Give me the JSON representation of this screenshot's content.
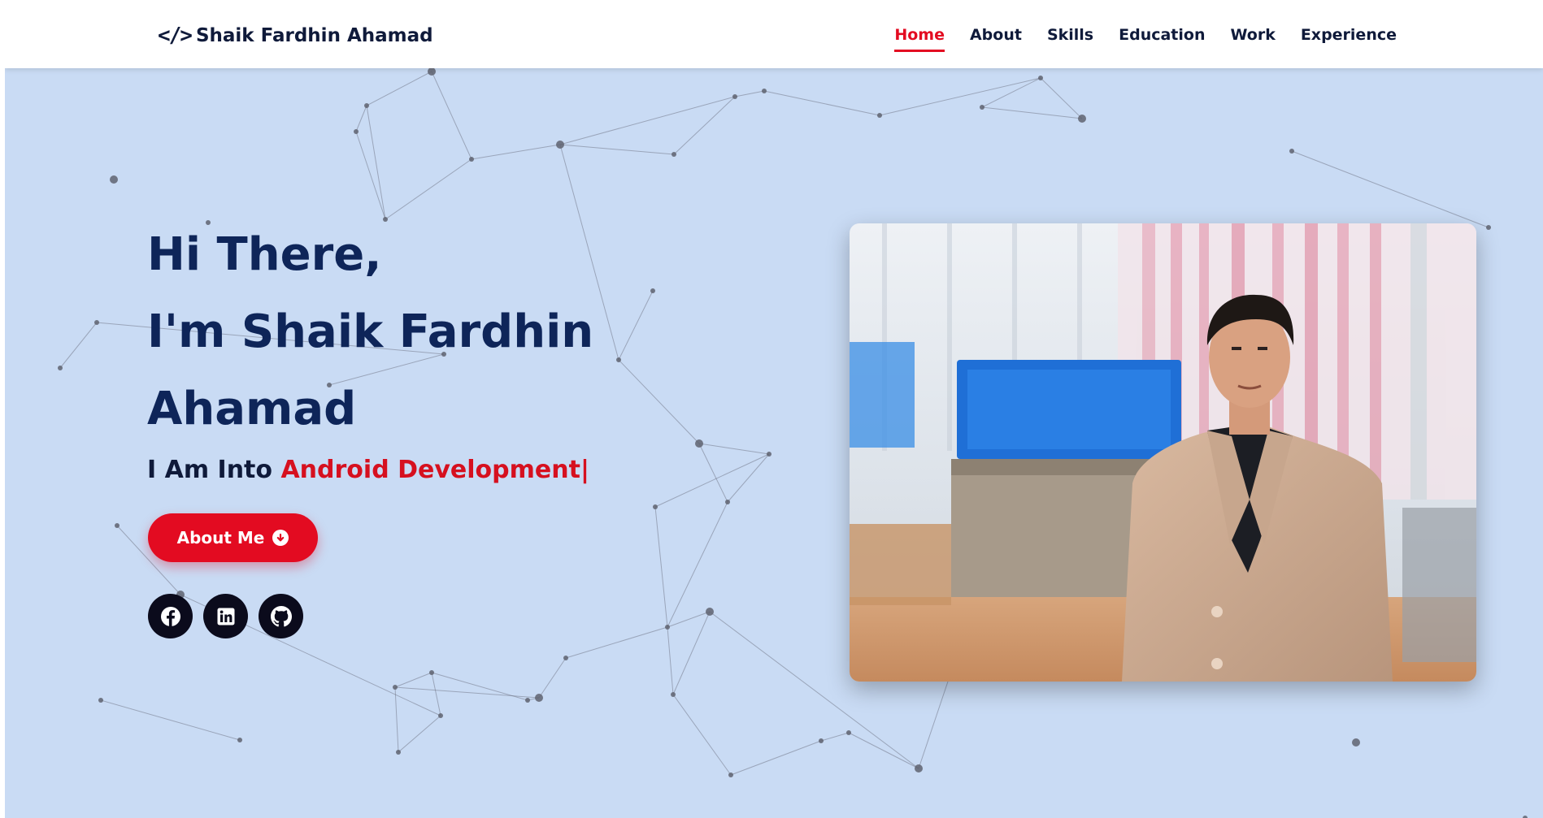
{
  "brand": {
    "icon": "code-icon",
    "name": "Shaik Fardhin Ahamad"
  },
  "nav": [
    {
      "label": "Home",
      "active": true
    },
    {
      "label": "About"
    },
    {
      "label": "Skills"
    },
    {
      "label": "Education"
    },
    {
      "label": "Work"
    },
    {
      "label": "Experience"
    }
  ],
  "hero": {
    "greeting": "Hi There,",
    "intro_line": "I'm Shaik Fardhin",
    "intro_line2": "Ahamad",
    "prefix": "I Am Into",
    "role": "Android Development",
    "caret": "|",
    "button_label": "About Me",
    "button_icon": "arrow-down-circle-icon",
    "socials": [
      "facebook-icon",
      "linkedin-icon",
      "github-icon"
    ]
  },
  "colors": {
    "accent": "#e30b21",
    "heading": "#0e2559",
    "background": "#c9dbf4",
    "nav_text": "#0f1a3a"
  }
}
